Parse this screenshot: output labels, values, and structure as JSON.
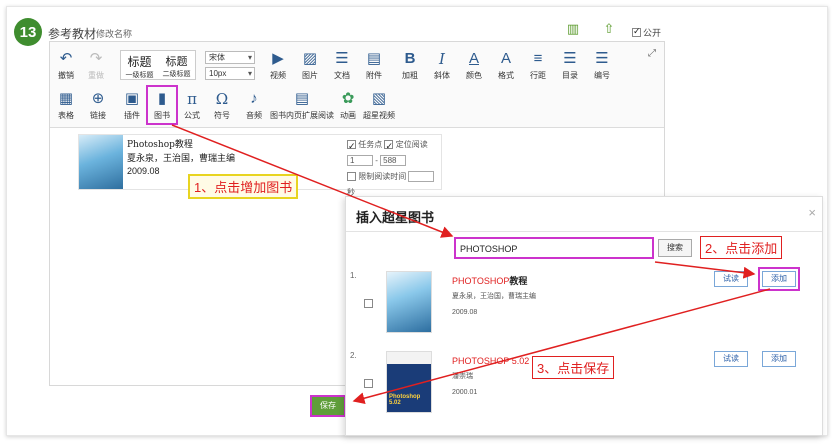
{
  "header": {
    "step_number": "13",
    "title": "参考教材",
    "edit_label": "修改名称",
    "public_label": "公开"
  },
  "toolbar": {
    "row1": [
      {
        "id": "undo",
        "label": "撤销",
        "icon": "undo-icon",
        "glyph": "↶"
      },
      {
        "id": "redo",
        "label": "重做",
        "icon": "redo-icon",
        "glyph": "↷"
      },
      {
        "id": "video",
        "label": "视频",
        "icon": "video-icon",
        "glyph": "▶"
      },
      {
        "id": "image",
        "label": "图片",
        "icon": "image-icon",
        "glyph": "▨"
      },
      {
        "id": "doc",
        "label": "文档",
        "icon": "document-icon",
        "glyph": "☰"
      },
      {
        "id": "attach",
        "label": "附件",
        "icon": "attachment-icon",
        "glyph": "▤"
      },
      {
        "id": "bold",
        "label": "加粗",
        "icon": "bold-icon",
        "glyph": "B"
      },
      {
        "id": "italic",
        "label": "斜体",
        "icon": "italic-icon",
        "glyph": "I"
      },
      {
        "id": "color",
        "label": "颜色",
        "icon": "font-color-icon",
        "glyph": "A"
      },
      {
        "id": "format",
        "label": "格式",
        "icon": "format-icon",
        "glyph": "A"
      },
      {
        "id": "linespacing",
        "label": "行距",
        "icon": "line-spacing-icon",
        "glyph": "≡"
      },
      {
        "id": "toc",
        "label": "目录",
        "icon": "toc-icon",
        "glyph": "☰"
      },
      {
        "id": "numbering",
        "label": "编号",
        "icon": "numbering-icon",
        "glyph": "☰"
      }
    ],
    "heading_big": "标题",
    "heading_small": "标题",
    "heading1_label": "一级标题",
    "heading2_label": "二级标题",
    "font_value": "宋体",
    "size_value": "10px",
    "row2": [
      {
        "id": "table",
        "label": "表格",
        "icon": "table-icon",
        "glyph": "▦"
      },
      {
        "id": "link",
        "label": "链接",
        "icon": "link-icon",
        "glyph": "⊕"
      },
      {
        "id": "plugin",
        "label": "插件",
        "icon": "plugin-icon",
        "glyph": "▣"
      },
      {
        "id": "book",
        "label": "图书",
        "icon": "book-icon",
        "glyph": "▮"
      },
      {
        "id": "formula",
        "label": "公式",
        "icon": "formula-icon",
        "glyph": "π"
      },
      {
        "id": "symbol",
        "label": "符号",
        "icon": "symbol-icon",
        "glyph": "Ω"
      },
      {
        "id": "audio",
        "label": "音频",
        "icon": "audio-icon",
        "glyph": "♪"
      },
      {
        "id": "pageext",
        "label": "图书内页扩展阅读",
        "icon": "page-extension-icon",
        "glyph": "▤"
      },
      {
        "id": "anim",
        "label": "动画",
        "icon": "animation-icon",
        "glyph": "✿"
      },
      {
        "id": "superstar",
        "label": "超星视频",
        "icon": "superstar-video-icon",
        "glyph": "▧"
      }
    ]
  },
  "inserted_book": {
    "title": "Photoshop教程",
    "authors": "夏永泉，王治国，曹瑞主编",
    "date": "2009.08",
    "task_point_label": "任务点",
    "locate_label": "定位阅读",
    "page_from": "1",
    "page_to": "588",
    "limit_label": "限制阅读时间",
    "limit_unit": "秒"
  },
  "save_label": "保存",
  "modal": {
    "title": "插入超星图书",
    "close": "×",
    "search_value": "PHOTOSHOP",
    "search_button": "搜索",
    "results": [
      {
        "index": "1.",
        "highlight": "PHOTOSHOP",
        "rest": "教程",
        "authors": "夏永泉，王治国，曹瑞主编",
        "date": "2009.08",
        "try_label": "试读",
        "add_label": "添加",
        "cover_text": ""
      },
      {
        "index": "2.",
        "highlight": "PHOTOSHOP",
        "rest": " 5.02",
        "authors": "潘崇瑞",
        "date": "2000.01",
        "try_label": "试读",
        "add_label": "添加",
        "cover_text": "Photoshop 5.02"
      }
    ]
  },
  "annotations": {
    "step1": "1、点击增加图书",
    "step2": "2、点击添加",
    "step3": "3、点击保存"
  },
  "colors": {
    "annotation": "#e02020",
    "highlight_box": "#cc33cc",
    "badge": "#3f8d2f",
    "save": "#5f9e3a"
  }
}
